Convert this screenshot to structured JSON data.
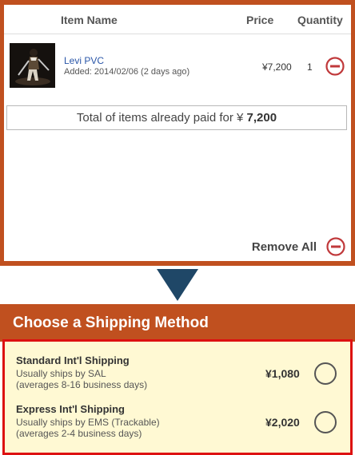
{
  "cart": {
    "headers": {
      "item_name": "Item Name",
      "price": "Price",
      "quantity": "Quantity"
    },
    "item": {
      "name": "Levi PVC",
      "added": "Added: 2014/02/06 (2 days ago)",
      "price": "¥7,200",
      "quantity": "1",
      "thumbnail_icon": "figure-image"
    },
    "total": {
      "label": "Total of items already paid for ¥",
      "amount": "7,200"
    },
    "remove_all_label": "Remove All"
  },
  "shipping": {
    "title": "Choose a Shipping Method",
    "options": [
      {
        "title": "Standard Int'l Shipping",
        "line1": "Usually ships by SAL",
        "line2": "(averages 8-16 business days)",
        "price": "¥1,080",
        "selected": false
      },
      {
        "title": "Express Int'l Shipping",
        "line1": "Usually ships by EMS (Trackable)",
        "line2": "(averages 2-4 business days)",
        "price": "¥2,020",
        "selected": false
      }
    ]
  },
  "colors": {
    "accent": "#c0501f",
    "remove_red": "#c0393b",
    "highlight_border": "#dd1111",
    "option_bg": "#fff9d3",
    "arrow": "#1f4767"
  }
}
